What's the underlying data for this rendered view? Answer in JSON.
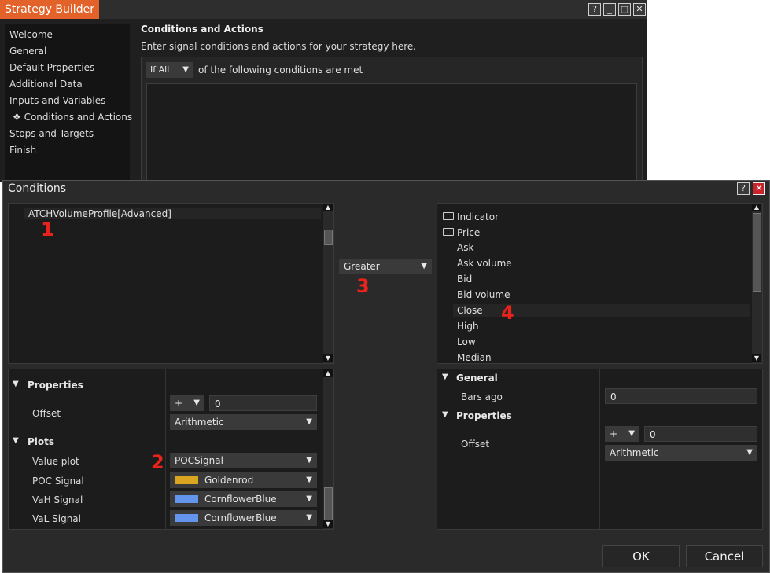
{
  "strategy_builder": {
    "title": "Strategy Builder",
    "window_buttons": [
      "?",
      "_",
      "□",
      "✕"
    ],
    "nav": [
      "Welcome",
      "General",
      "Default Properties",
      "Additional Data",
      "Inputs and Variables",
      "❖ Conditions and Actions",
      "Stops and Targets",
      "Finish"
    ],
    "heading": "Conditions and Actions",
    "description": "Enter signal conditions and actions for your strategy here.",
    "if_select": "If All",
    "if_text": "of the following conditions are met"
  },
  "conditions": {
    "title": "Conditions",
    "left_item": "ATCHVolumeProfile[Advanced]",
    "operator": "Greater",
    "right_tree": {
      "folders": [
        "Indicator",
        "Price"
      ],
      "price_items": [
        "Ask",
        "Ask volume",
        "Bid",
        "Bid volume",
        "Close",
        "High",
        "Low",
        "Median"
      ]
    },
    "left_props": {
      "properties_label": "Properties",
      "offset_label": "Offset",
      "offset_sign": "+",
      "offset_value": "0",
      "offset_mode": "Arithmetic",
      "plots_label": "Plots",
      "value_plot_label": "Value plot",
      "value_plot": "POCSignal",
      "poc_label": "POC Signal",
      "poc_color": "Goldenrod",
      "vah_label": "VaH Signal",
      "vah_color": "CornflowerBlue",
      "val_label": "VaL Signal",
      "val_color": "CornflowerBlue"
    },
    "right_props": {
      "general_label": "General",
      "bars_ago_label": "Bars ago",
      "bars_ago_value": "0",
      "properties_label": "Properties",
      "offset_label": "Offset",
      "offset_sign": "+",
      "offset_value": "0",
      "offset_mode": "Arithmetic"
    },
    "ok_label": "OK",
    "cancel_label": "Cancel"
  },
  "annotations": [
    "1",
    "2",
    "3",
    "4"
  ],
  "colors": {
    "accent": "#e2622a",
    "goldenrod": "#daa520",
    "cornflowerblue": "#6495ed",
    "annotation": "#e8231b"
  }
}
